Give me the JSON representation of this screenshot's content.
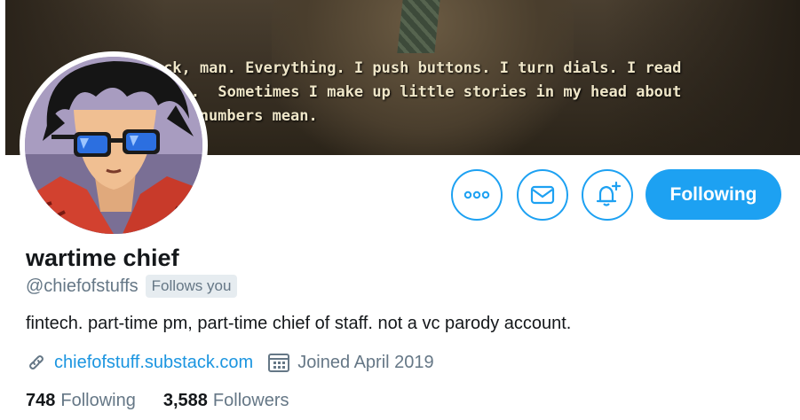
{
  "banner": {
    "subtitle_lines": [
      "ck, man. Everything. I push buttons. I turn dials. I read",
      "ers.  Sometimes I make up little stories in my head about",
      "he numbers mean."
    ]
  },
  "actions": {
    "more_icon": "more-horizontal-icon",
    "message_icon": "envelope-icon",
    "notify_icon": "bell-plus-icon",
    "follow_label": "Following"
  },
  "profile": {
    "display_name": "wartime chief",
    "handle": "@chiefofstuffs",
    "follows_you": "Follows you",
    "bio": "fintech. part-time pm, part-time chief of staff. not a vc parody account.",
    "website": "chiefofstuff.substack.com",
    "joined": "Joined April 2019"
  },
  "stats": {
    "following_count": "748",
    "following_label": "Following",
    "followers_count": "3,588",
    "followers_label": "Followers"
  },
  "colors": {
    "accent": "#1da1f2",
    "link": "#1b95e0",
    "muted": "#657786"
  }
}
